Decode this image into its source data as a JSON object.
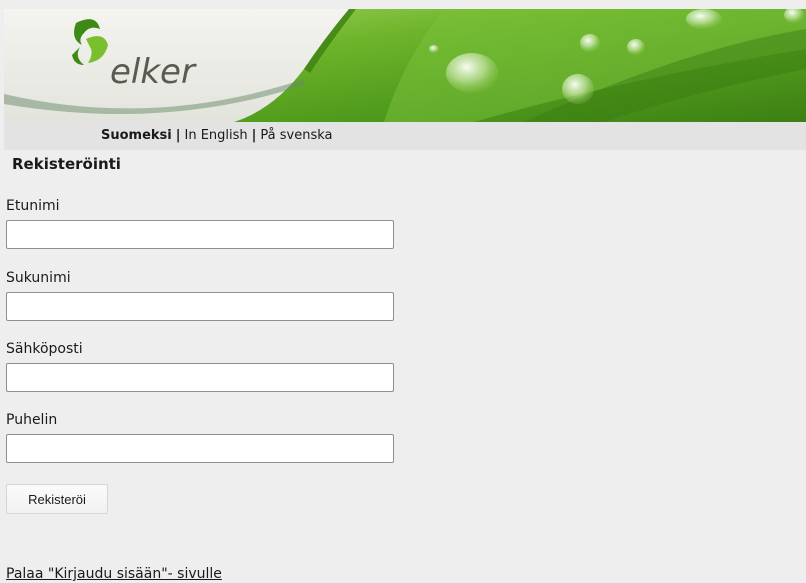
{
  "brand": {
    "logo_text": "elker"
  },
  "language_bar": {
    "items": [
      {
        "label": "Suomeksi",
        "active": true
      },
      {
        "label": "In English",
        "active": false
      },
      {
        "label": "På svenska",
        "active": false
      }
    ],
    "separator": "|"
  },
  "form": {
    "title": "Rekisteröinti",
    "fields": [
      {
        "label": "Etunimi",
        "value": ""
      },
      {
        "label": "Sukunimi",
        "value": ""
      },
      {
        "label": "Sähköposti",
        "value": ""
      },
      {
        "label": "Puhelin",
        "value": ""
      }
    ],
    "submit_label": "Rekisteröi"
  },
  "footer": {
    "back_link": "Palaa \"Kirjaudu sisään\"- sivulle"
  },
  "colors": {
    "background": "#eeeeee",
    "language_bar": "#e3e3e3",
    "banner_green": "#5fa01f",
    "logo_green": "#3f8a17"
  }
}
